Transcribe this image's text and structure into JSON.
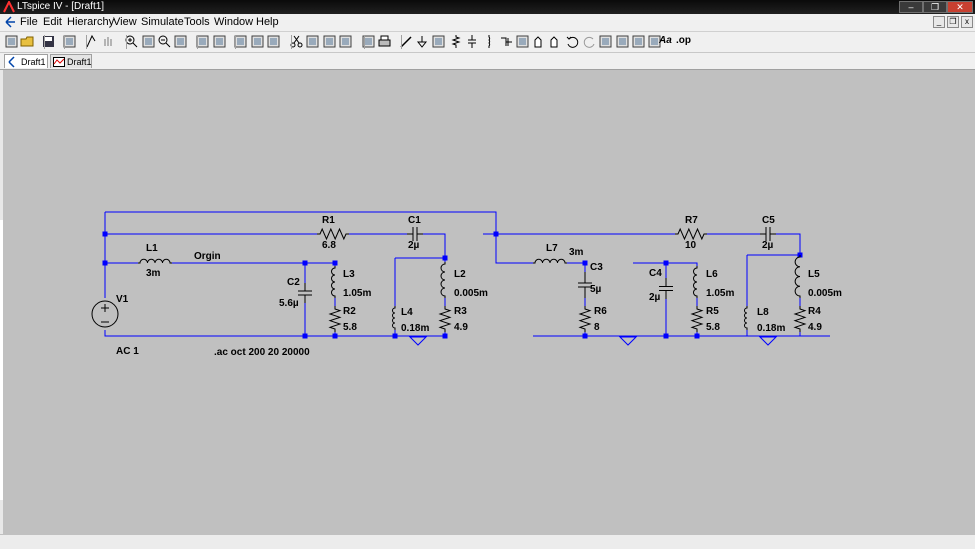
{
  "window": {
    "title": "LTspice IV - [Draft1]"
  },
  "menu": {
    "items": [
      "File",
      "Edit",
      "Hierarchy",
      "View",
      "Simulate",
      "Tools",
      "Window",
      "Help"
    ]
  },
  "tabs": [
    {
      "label": "Draft1",
      "icon": "schematic-icon"
    },
    {
      "label": "Draft1",
      "icon": "waveform-icon"
    }
  ],
  "toolbar": {
    "icons": [
      "autorange-icon",
      "open-icon",
      "save-icon",
      "control-panel-icon",
      "run-icon",
      "halt-icon",
      "zoom-in-icon",
      "pan-icon",
      "zoom-out-icon",
      "zoom-full-icon",
      "new-schematic-icon",
      "waveform-icon",
      "tile-horizontal-icon",
      "cascade-icon",
      "tile-vertical-icon",
      "cut-icon",
      "copy-icon",
      "paste-icon",
      "find-icon",
      "print-setup-icon",
      "print-icon",
      "wire-icon",
      "ground-icon",
      "label-net-icon",
      "resistor-icon",
      "capacitor-icon",
      "inductor-icon",
      "diode-icon",
      "component-icon",
      "move-icon",
      "drag-icon",
      "undo-icon",
      "redo-icon",
      "rotate-icon",
      "mirror-icon",
      "text-icon",
      "spice-directive-icon"
    ],
    "text_label": "Aa",
    "op_label": ".op"
  },
  "schematic": {
    "components": {
      "V1": {
        "name": "V1",
        "value": "AC 1"
      },
      "L1": {
        "name": "L1",
        "value": "3m"
      },
      "R1": {
        "name": "R1",
        "value": "6.8"
      },
      "C1": {
        "name": "C1",
        "value": "2µ"
      },
      "C2": {
        "name": "C2",
        "value": "5.6µ"
      },
      "L3": {
        "name": "L3",
        "value": "1.05m"
      },
      "R2": {
        "name": "R2",
        "value": "5.8"
      },
      "L4": {
        "name": "L4",
        "value": "0.18m"
      },
      "L2": {
        "name": "L2",
        "value": "0.005m"
      },
      "R3": {
        "name": "R3",
        "value": "4.9"
      },
      "L7": {
        "name": "L7",
        "value": "3m"
      },
      "C3": {
        "name": "C3",
        "value": "5µ"
      },
      "R6": {
        "name": "R6",
        "value": "8"
      },
      "C4": {
        "name": "C4",
        "value": "2µ"
      },
      "L6": {
        "name": "L6",
        "value": "1.05m"
      },
      "R5": {
        "name": "R5",
        "value": "5.8"
      },
      "R7": {
        "name": "R7",
        "value": "10"
      },
      "C5": {
        "name": "C5",
        "value": "2µ"
      },
      "L8": {
        "name": "L8",
        "value": "0.18m"
      },
      "L5": {
        "name": "L5",
        "value": "0.005m"
      },
      "R4": {
        "name": "R4",
        "value": "4.9"
      }
    },
    "net_label": "Orgin",
    "directive": ".ac oct 200 20 20000"
  },
  "colors": {
    "wire": "#0000ff",
    "canvas": "#c0c0c0",
    "component": "#000000"
  }
}
